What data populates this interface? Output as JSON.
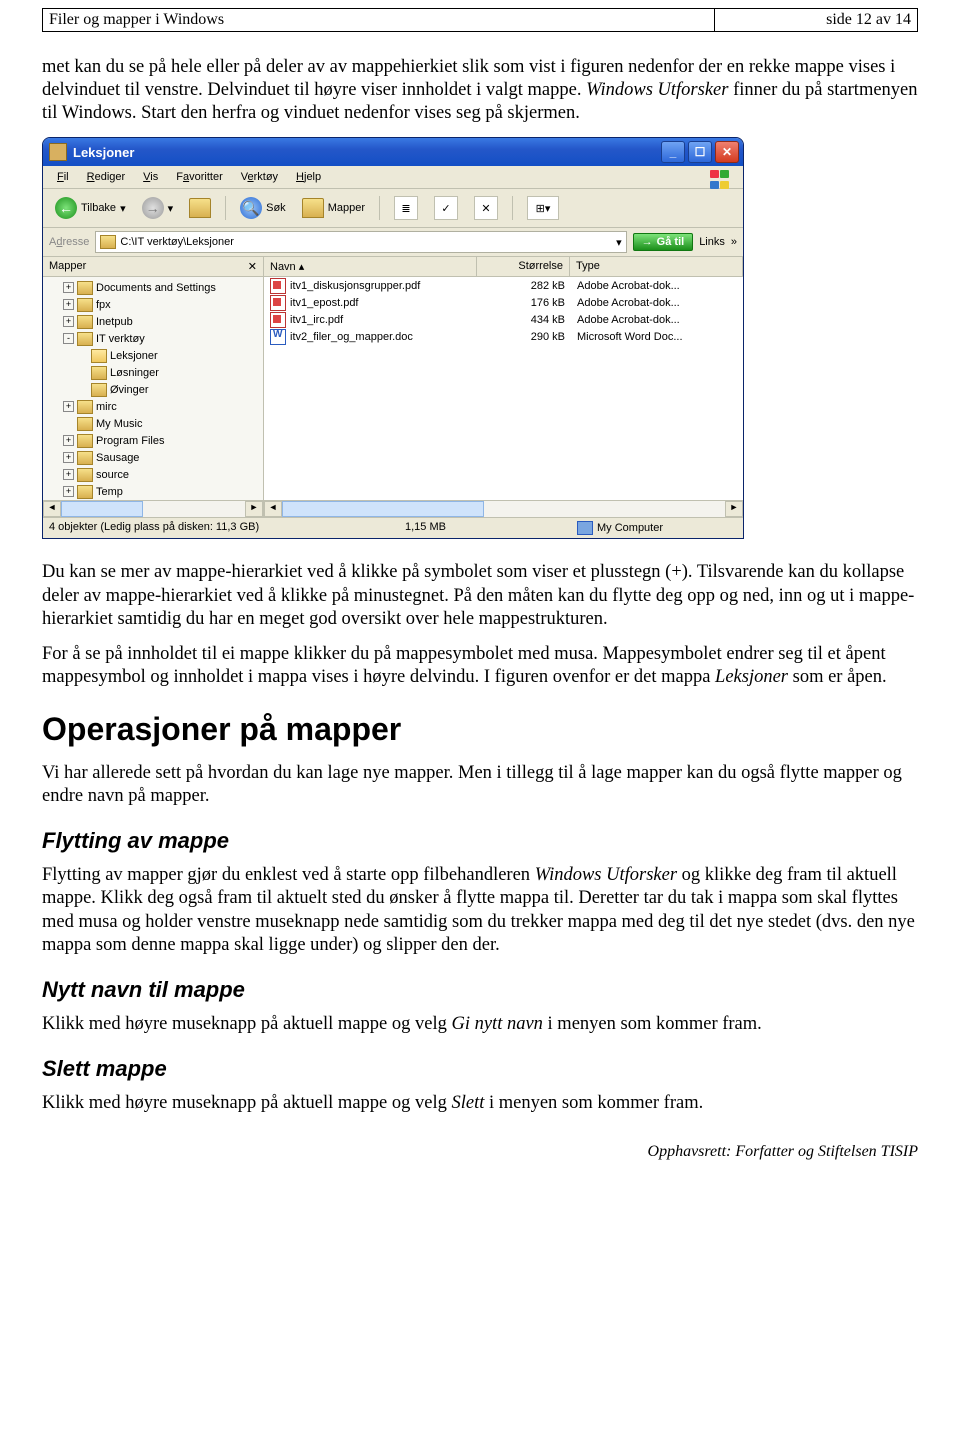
{
  "header": {
    "doc_title": "Filer og mapper i Windows",
    "page_indicator": "side 12 av 14"
  },
  "para1": "met kan du se på hele eller på deler av av mappehierkiet slik som vist i figuren nedenfor der en rekke mappe vises i delvinduet til venstre. Delvinduet til høyre viser innholdet i valgt mappe. ",
  "para1_em": "Windows Utforsker",
  "para1_rest": " finner du på startmenyen til Windows. Start den herfra og vinduet nedenfor vises seg på skjermen.",
  "screenshot": {
    "window_title": "Leksjoner",
    "menus": [
      "Fil",
      "Rediger",
      "Vis",
      "Favoritter",
      "Verktøy",
      "Hjelp"
    ],
    "toolbar": {
      "back": "Tilbake",
      "search": "Søk",
      "folders": "Mapper"
    },
    "address_label": "Adresse",
    "address_value": "C:\\IT verktøy\\Leksjoner",
    "go_label": "Gå til",
    "links_label": "Links",
    "left_header": "Mapper",
    "tree": [
      {
        "exp": "+",
        "name": "Documents and Settings",
        "ind": 1
      },
      {
        "exp": "+",
        "name": "fpx",
        "ind": 1
      },
      {
        "exp": "+",
        "name": "Inetpub",
        "ind": 1
      },
      {
        "exp": "-",
        "name": "IT verktøy",
        "ind": 1
      },
      {
        "exp": "",
        "name": "Leksjoner",
        "ind": 2,
        "open": true
      },
      {
        "exp": "",
        "name": "Løsninger",
        "ind": 2
      },
      {
        "exp": "",
        "name": "Øvinger",
        "ind": 2
      },
      {
        "exp": "+",
        "name": "mirc",
        "ind": 1
      },
      {
        "exp": "",
        "name": "My Music",
        "ind": 1
      },
      {
        "exp": "+",
        "name": "Program Files",
        "ind": 1
      },
      {
        "exp": "+",
        "name": "Sausage",
        "ind": 1
      },
      {
        "exp": "+",
        "name": "source",
        "ind": 1
      },
      {
        "exp": "+",
        "name": "Temp",
        "ind": 1
      }
    ],
    "columns": {
      "name": "Navn",
      "size": "Størrelse",
      "type": "Type"
    },
    "files": [
      {
        "icon": "pdf",
        "name": "itv1_diskusjonsgrupper.pdf",
        "size": "282 kB",
        "type": "Adobe Acrobat-dok..."
      },
      {
        "icon": "pdf",
        "name": "itv1_epost.pdf",
        "size": "176 kB",
        "type": "Adobe Acrobat-dok..."
      },
      {
        "icon": "pdf",
        "name": "itv1_irc.pdf",
        "size": "434 kB",
        "type": "Adobe Acrobat-dok..."
      },
      {
        "icon": "doc",
        "name": "itv2_filer_og_mapper.doc",
        "size": "290 kB",
        "type": "Microsoft Word Doc..."
      }
    ],
    "status": {
      "left": "4 objekter (Ledig plass på disken: 11,3 GB)",
      "mid": "1,15 MB",
      "right": "My Computer"
    }
  },
  "para2": "Du kan se mer av mappe-hierarkiet ved å klikke på symbolet som viser et plusstegn (+). Tilsvarende kan du kollapse deler av mappe-hierarkiet ved å klikke på minustegnet. På den måten kan du flytte deg opp og ned, inn og ut i mappe-hierarkiet samtidig du har en meget god oversikt over hele mappestrukturen.",
  "para3a": "For å se på innholdet til ei mappe klikker du på mappesymbolet med musa. Mappesymbolet endrer seg til et åpent mappesymbol og innholdet i mappa vises i høyre delvindu. I figuren ovenfor  er det mappa ",
  "para3_em": "Leksjoner",
  "para3b": " som er åpen.",
  "h1": "Operasjoner på mapper",
  "para4": "Vi har allerede sett på hvordan du kan lage nye mapper. Men i tillegg til å lage mapper kan du også flytte mapper og endre navn på mapper.",
  "h2a": "Flytting av mappe",
  "para5a": "Flytting av mapper gjør du enklest ved å starte opp filbehandleren ",
  "para5_em": "Windows Utforsker",
  "para5b": " og klikke deg fram til aktuell mappe. Klikk deg også fram til aktuelt sted du ønsker å flytte mappa til. Deretter tar du tak i mappa som skal flyttes med musa og holder venstre museknapp nede samtidig som du trekker mappa med deg til det nye stedet (dvs. den nye mappa som denne mappa skal ligge under) og slipper den der.",
  "h2b": "Nytt navn til mappe",
  "para6a": "Klikk med høyre museknapp på aktuell mappe og velg ",
  "para6_em": "Gi nytt navn",
  "para6b": " i menyen som kommer fram.",
  "h2c": "Slett mappe",
  "para7a": "Klikk med høyre museknapp på aktuell mappe og velg ",
  "para7_em": "Slett",
  "para7b": " i menyen som kommer fram.",
  "footer": "Opphavsrett:  Forfatter og Stiftelsen TISIP"
}
